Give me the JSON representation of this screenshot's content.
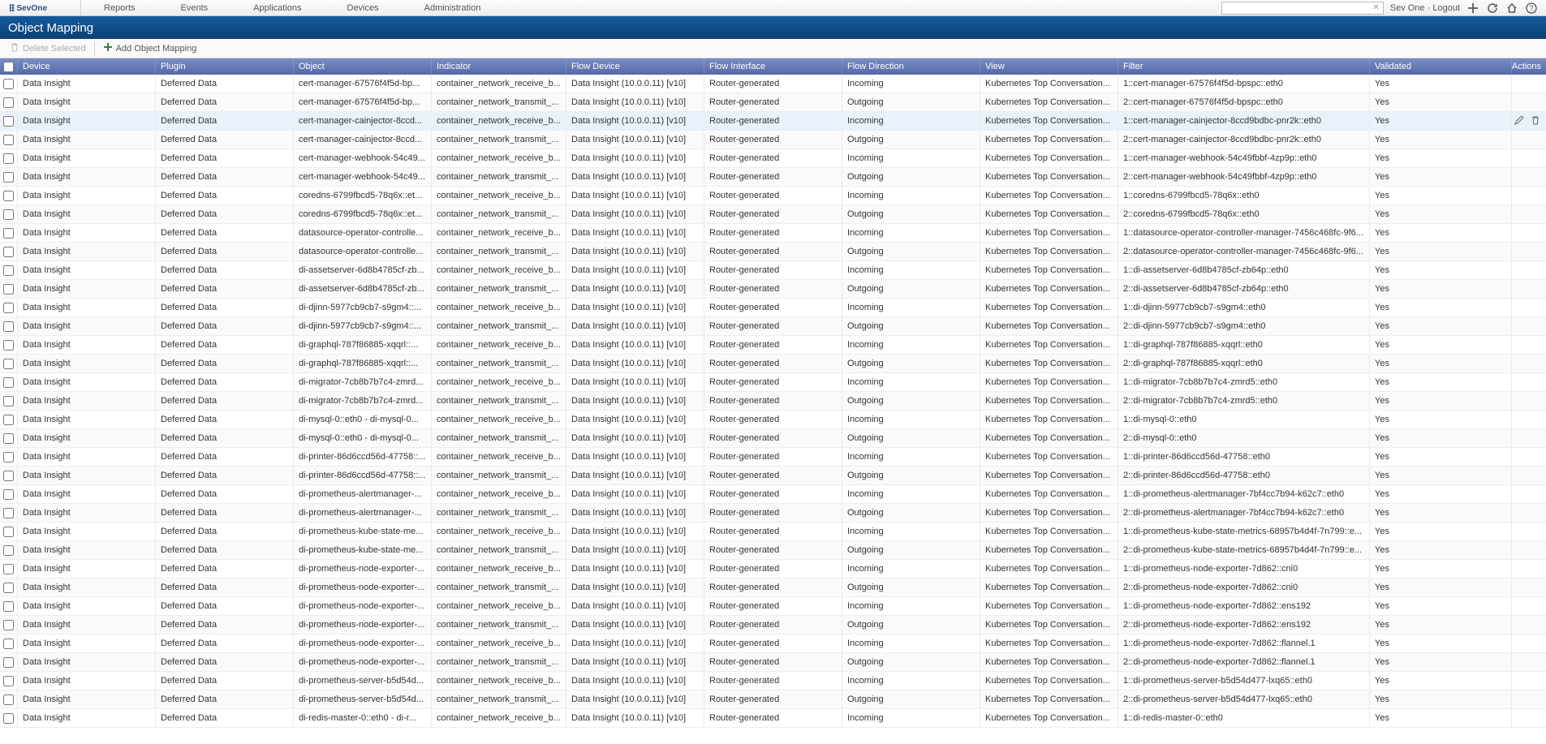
{
  "brand": "SevOne",
  "user": {
    "name": "Sev One",
    "logout": "Logout"
  },
  "nav": [
    "Reports",
    "Events",
    "Applications",
    "Devices",
    "Administration"
  ],
  "search": {
    "placeholder": ""
  },
  "page_title": "Object Mapping",
  "toolbar": {
    "delete": "Delete Selected",
    "add": "Add Object Mapping"
  },
  "columns": {
    "device": "Device",
    "plugin": "Plugin",
    "object": "Object",
    "indicator": "Indicator",
    "flowdev": "Flow Device",
    "flowif": "Flow Interface",
    "flowdir": "Flow Direction",
    "view": "View",
    "filter": "Filter",
    "validated": "Validated",
    "actions": "Actions"
  },
  "common": {
    "device": "Data Insight",
    "plugin": "Deferred Data",
    "flowdev": "Data Insight (10.0.0.11) [v10]",
    "flowif": "Router-generated",
    "view": "Kubernetes Top Conversation...",
    "validated": "Yes"
  },
  "hover_index": 2,
  "rows": [
    {
      "object": "cert-manager-67576f4f5d-bp...",
      "indicator": "container_network_receive_b...",
      "flowdir": "Incoming",
      "filter": "1::cert-manager-67576f4f5d-bpspc::eth0"
    },
    {
      "object": "cert-manager-67576f4f5d-bp...",
      "indicator": "container_network_transmit_...",
      "flowdir": "Outgoing",
      "filter": "2::cert-manager-67576f4f5d-bpspc::eth0"
    },
    {
      "object": "cert-manager-cainjector-8ccd...",
      "indicator": "container_network_receive_b...",
      "flowdir": "Incoming",
      "filter": "1::cert-manager-cainjector-8ccd9bdbc-pnr2k::eth0"
    },
    {
      "object": "cert-manager-cainjector-8ccd...",
      "indicator": "container_network_transmit_...",
      "flowdir": "Outgoing",
      "filter": "2::cert-manager-cainjector-8ccd9bdbc-pnr2k::eth0"
    },
    {
      "object": "cert-manager-webhook-54c49...",
      "indicator": "container_network_receive_b...",
      "flowdir": "Incoming",
      "filter": "1::cert-manager-webhook-54c49fbbf-4zp9p::eth0"
    },
    {
      "object": "cert-manager-webhook-54c49...",
      "indicator": "container_network_transmit_...",
      "flowdir": "Outgoing",
      "filter": "2::cert-manager-webhook-54c49fbbf-4zp9p::eth0"
    },
    {
      "object": "coredns-6799fbcd5-78q6x::et...",
      "indicator": "container_network_receive_b...",
      "flowdir": "Incoming",
      "filter": "1::coredns-6799fbcd5-78q6x::eth0"
    },
    {
      "object": "coredns-6799fbcd5-78q6x::et...",
      "indicator": "container_network_transmit_...",
      "flowdir": "Outgoing",
      "filter": "2::coredns-6799fbcd5-78q6x::eth0"
    },
    {
      "object": "datasource-operator-controlle...",
      "indicator": "container_network_receive_b...",
      "flowdir": "Incoming",
      "filter": "1::datasource-operator-controller-manager-7456c468fc-9f6..."
    },
    {
      "object": "datasource-operator-controlle...",
      "indicator": "container_network_transmit_...",
      "flowdir": "Outgoing",
      "filter": "2::datasource-operator-controller-manager-7456c468fc-9f6..."
    },
    {
      "object": "di-assetserver-6d8b4785cf-zb...",
      "indicator": "container_network_receive_b...",
      "flowdir": "Incoming",
      "filter": "1::di-assetserver-6d8b4785cf-zb64p::eth0"
    },
    {
      "object": "di-assetserver-6d8b4785cf-zb...",
      "indicator": "container_network_transmit_...",
      "flowdir": "Outgoing",
      "filter": "2::di-assetserver-6d8b4785cf-zb64p::eth0"
    },
    {
      "object": "di-djinn-5977cb9cb7-s9gm4::...",
      "indicator": "container_network_receive_b...",
      "flowdir": "Incoming",
      "filter": "1::di-djinn-5977cb9cb7-s9gm4::eth0"
    },
    {
      "object": "di-djinn-5977cb9cb7-s9gm4::...",
      "indicator": "container_network_transmit_...",
      "flowdir": "Outgoing",
      "filter": "2::di-djinn-5977cb9cb7-s9gm4::eth0"
    },
    {
      "object": "di-graphql-787f86885-xqqrl::...",
      "indicator": "container_network_receive_b...",
      "flowdir": "Incoming",
      "filter": "1::di-graphql-787f86885-xqqrl::eth0"
    },
    {
      "object": "di-graphql-787f86885-xqqrl::...",
      "indicator": "container_network_transmit_...",
      "flowdir": "Outgoing",
      "filter": "2::di-graphql-787f86885-xqqrl::eth0"
    },
    {
      "object": "di-migrator-7cb8b7b7c4-zmrd...",
      "indicator": "container_network_receive_b...",
      "flowdir": "Incoming",
      "filter": "1::di-migrator-7cb8b7b7c4-zmrd5::eth0"
    },
    {
      "object": "di-migrator-7cb8b7b7c4-zmrd...",
      "indicator": "container_network_transmit_...",
      "flowdir": "Outgoing",
      "filter": "2::di-migrator-7cb8b7b7c4-zmrd5::eth0"
    },
    {
      "object": "di-mysql-0::eth0 - di-mysql-0...",
      "indicator": "container_network_receive_b...",
      "flowdir": "Incoming",
      "filter": "1::di-mysql-0::eth0"
    },
    {
      "object": "di-mysql-0::eth0 - di-mysql-0...",
      "indicator": "container_network_transmit_...",
      "flowdir": "Outgoing",
      "filter": "2::di-mysql-0::eth0"
    },
    {
      "object": "di-printer-86d6ccd56d-47758::...",
      "indicator": "container_network_receive_b...",
      "flowdir": "Incoming",
      "filter": "1::di-printer-86d6ccd56d-47758::eth0"
    },
    {
      "object": "di-printer-86d6ccd56d-47758::...",
      "indicator": "container_network_transmit_...",
      "flowdir": "Outgoing",
      "filter": "2::di-printer-86d6ccd56d-47758::eth0"
    },
    {
      "object": "di-prometheus-alertmanager-...",
      "indicator": "container_network_receive_b...",
      "flowdir": "Incoming",
      "filter": "1::di-prometheus-alertmanager-7bf4cc7b94-k62c7::eth0"
    },
    {
      "object": "di-prometheus-alertmanager-...",
      "indicator": "container_network_transmit_...",
      "flowdir": "Outgoing",
      "filter": "2::di-prometheus-alertmanager-7bf4cc7b94-k62c7::eth0"
    },
    {
      "object": "di-prometheus-kube-state-me...",
      "indicator": "container_network_receive_b...",
      "flowdir": "Incoming",
      "filter": "1::di-prometheus-kube-state-metrics-68957b4d4f-7n799::e..."
    },
    {
      "object": "di-prometheus-kube-state-me...",
      "indicator": "container_network_transmit_...",
      "flowdir": "Outgoing",
      "filter": "2::di-prometheus-kube-state-metrics-68957b4d4f-7n799::e..."
    },
    {
      "object": "di-prometheus-node-exporter-...",
      "indicator": "container_network_receive_b...",
      "flowdir": "Incoming",
      "filter": "1::di-prometheus-node-exporter-7d862::cni0"
    },
    {
      "object": "di-prometheus-node-exporter-...",
      "indicator": "container_network_transmit_...",
      "flowdir": "Outgoing",
      "filter": "2::di-prometheus-node-exporter-7d862::cni0"
    },
    {
      "object": "di-prometheus-node-exporter-...",
      "indicator": "container_network_receive_b...",
      "flowdir": "Incoming",
      "filter": "1::di-prometheus-node-exporter-7d862::ens192"
    },
    {
      "object": "di-prometheus-node-exporter-...",
      "indicator": "container_network_transmit_...",
      "flowdir": "Outgoing",
      "filter": "2::di-prometheus-node-exporter-7d862::ens192"
    },
    {
      "object": "di-prometheus-node-exporter-...",
      "indicator": "container_network_receive_b...",
      "flowdir": "Incoming",
      "filter": "1::di-prometheus-node-exporter-7d862::flannel.1"
    },
    {
      "object": "di-prometheus-node-exporter-...",
      "indicator": "container_network_transmit_...",
      "flowdir": "Outgoing",
      "filter": "2::di-prometheus-node-exporter-7d862::flannel.1"
    },
    {
      "object": "di-prometheus-server-b5d54d...",
      "indicator": "container_network_receive_b...",
      "flowdir": "Incoming",
      "filter": "1::di-prometheus-server-b5d54d477-lxq65::eth0"
    },
    {
      "object": "di-prometheus-server-b5d54d...",
      "indicator": "container_network_transmit_...",
      "flowdir": "Outgoing",
      "filter": "2::di-prometheus-server-b5d54d477-lxq65::eth0"
    },
    {
      "object": "di-redis-master-0::eth0 - di-r...",
      "indicator": "container_network_receive_b...",
      "flowdir": "Incoming",
      "filter": "1::di-redis-master-0::eth0"
    }
  ]
}
